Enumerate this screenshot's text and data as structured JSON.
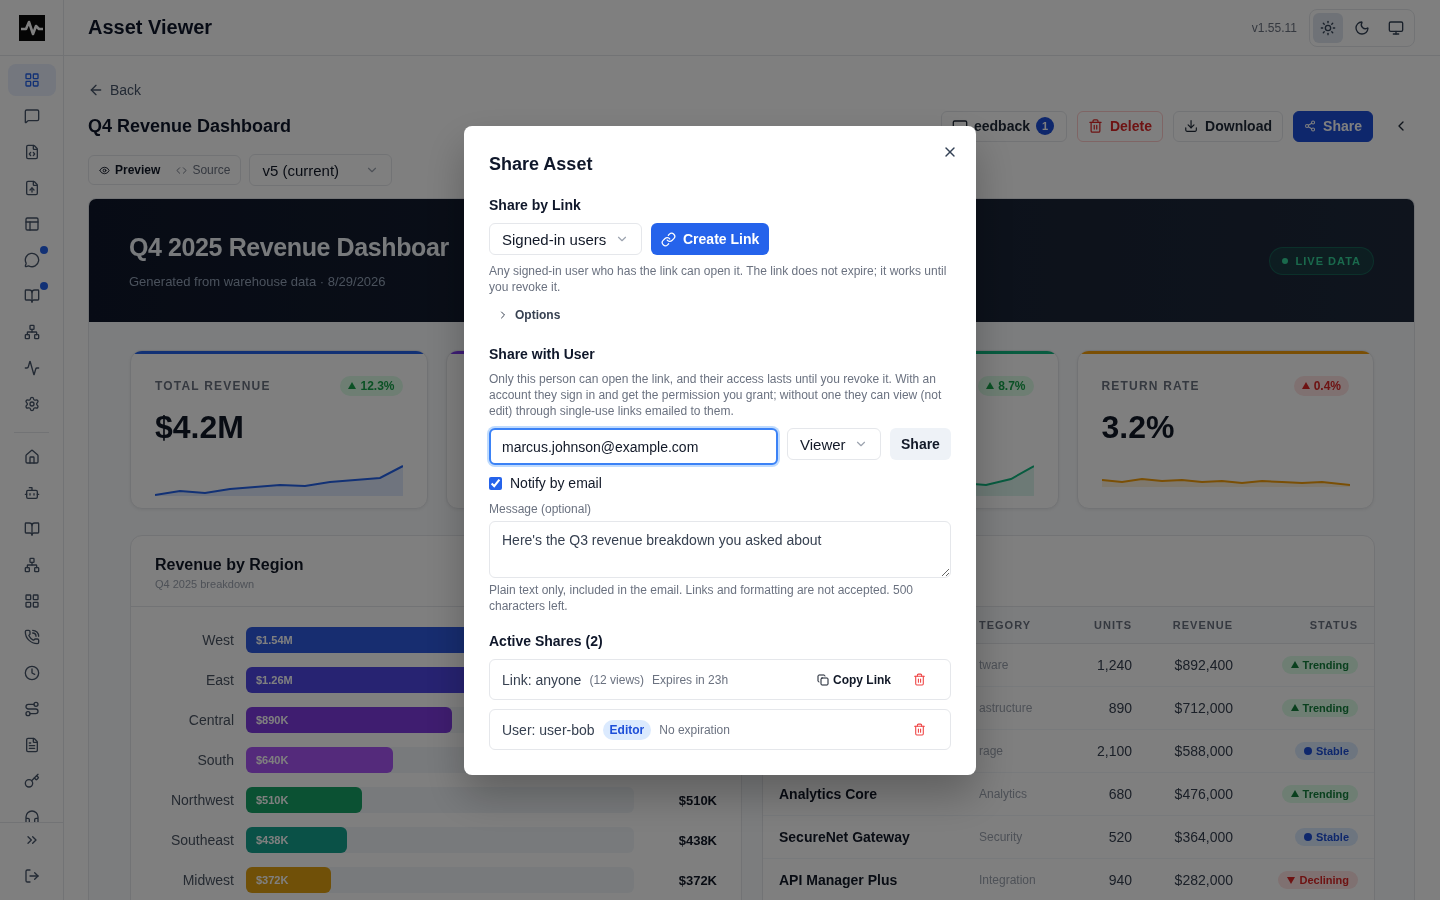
{
  "app": {
    "title": "Asset Viewer",
    "version": "v1.55.11"
  },
  "theme_options": [
    {
      "selected": true
    },
    {
      "selected": false
    },
    {
      "selected": false
    }
  ],
  "nav": {
    "primary": [
      {
        "selected": true,
        "unread": false
      },
      {
        "selected": false,
        "unread": false
      },
      {
        "selected": false,
        "unread": false
      },
      {
        "selected": false,
        "unread": false
      },
      {
        "selected": false,
        "unread": false
      },
      {
        "selected": false,
        "unread": true
      },
      {
        "selected": false,
        "unread": true
      },
      {
        "selected": false,
        "unread": false
      },
      {
        "selected": false,
        "unread": false
      },
      {
        "selected": false,
        "unread": false
      }
    ],
    "secondary": [
      {
        "selected": false
      },
      {
        "selected": false
      },
      {
        "selected": false
      },
      {
        "selected": false
      },
      {
        "selected": false
      },
      {
        "selected": false
      },
      {
        "selected": false
      },
      {
        "selected": false
      },
      {
        "selected": false
      },
      {
        "selected": false
      },
      {
        "selected": false
      }
    ]
  },
  "back": "Back",
  "page_title": "Q4 Revenue Dashboard",
  "actions": [
    {
      "kind": "feedback",
      "label": "eedback",
      "count": "1"
    },
    {
      "kind": "delete",
      "label": "Delete"
    },
    {
      "kind": "download",
      "label": "Download"
    },
    {
      "kind": "share",
      "label": "Share"
    }
  ],
  "view_tabs": [
    {
      "label": "Preview",
      "selected": true
    },
    {
      "label": "Source",
      "selected": false
    }
  ],
  "version_select": {
    "value": "v5 (current)"
  },
  "hero": {
    "title": "Q4 2025 Revenue Dashboar",
    "subtitle": "Generated from warehouse data · 8/29/2026",
    "badge": "LIVE DATA"
  },
  "kpis": [
    {
      "label": "TOTAL REVENUE",
      "value": "$4.2M",
      "delta": "12.3%",
      "negative": false,
      "color": "#123175"
    },
    {
      "color": "#3e1d76"
    },
    {
      "delta": "8.7%",
      "negative": false,
      "color": "#085c40"
    },
    {
      "label": "RETURN RATE",
      "value": "3.2%",
      "delta": "0.4%",
      "negative": true,
      "color": "#7a4f05"
    }
  ],
  "regions": {
    "title": "Revenue by Region",
    "subtitle": "Q4 2025 breakdown",
    "rows": [
      {
        "name": "West",
        "bar_label": "$1.54M",
        "level": 1,
        "color": "#172d70"
      },
      {
        "name": "East",
        "bar_label": "$1.26M",
        "level": 0.82,
        "color": "#272372"
      },
      {
        "name": "Central",
        "bar_label": "$890K",
        "level": 0.53,
        "color": "#3f1d70"
      },
      {
        "name": "South",
        "bar_label": "$640K",
        "level": 0.38,
        "color": "#542a7b"
      },
      {
        "name": "Northwest",
        "bar_label": "$510K",
        "value": "$510K",
        "level": 0.3,
        "color": "#0b5133"
      },
      {
        "name": "Southeast",
        "bar_label": "$438K",
        "value": "$438K",
        "level": 0.26,
        "color": "#0a5147"
      },
      {
        "name": "Midwest",
        "bar_label": "$372K",
        "value": "$372K",
        "level": 0.22,
        "color": "#705008"
      }
    ]
  },
  "products": {
    "columns": [
      "TEGORY",
      "UNITS",
      "REVENUE",
      "STATUS"
    ],
    "rows": [
      {
        "category": "tware",
        "units": "1,240",
        "revenue": "$892,400",
        "status": {
          "kind": "trending",
          "label": "Trending"
        }
      },
      {
        "category": "astructure",
        "units": "890",
        "revenue": "$712,000",
        "status": {
          "kind": "trending",
          "label": "Trending"
        }
      },
      {
        "category": "rage",
        "units": "2,100",
        "revenue": "$588,000",
        "status": {
          "kind": "stable",
          "label": "Stable"
        }
      },
      {
        "name": "Analytics Core",
        "category": "Analytics",
        "units": "680",
        "revenue": "$476,000",
        "status": {
          "kind": "trending",
          "label": "Trending"
        }
      },
      {
        "name": "SecureNet Gateway",
        "category": "Security",
        "units": "520",
        "revenue": "$364,000",
        "status": {
          "kind": "stable",
          "label": "Stable"
        }
      },
      {
        "name": "API Manager Plus",
        "category": "Integration",
        "units": "940",
        "revenue": "$282,000",
        "status": {
          "kind": "declining",
          "label": "Declining"
        }
      }
    ]
  },
  "modal": {
    "title": "Share Asset",
    "link_section": {
      "heading": "Share by Link",
      "audience": "Signed-in users",
      "create_label": "Create Link",
      "help": "Any signed-in user who has the link can open it. The link does not expire; it works until you revoke it.",
      "options": {
        "label": "Options",
        "expanded": false
      }
    },
    "user_section": {
      "heading": "Share with User",
      "help": "Only this person can open the link, and their access lasts until you revoke it. With an account they sign in and get the permission you grant; without one they can view (not edit) through single-use links emailed to them.",
      "email": "marcus.johnson@example.com",
      "role": "Viewer",
      "share_label": "Share",
      "notify": {
        "label": "Notify by email",
        "checked": true
      },
      "message_label": "Message (optional)",
      "message": "Here's the Q3 revenue breakdown you asked about",
      "message_help": "Plain text only, included in the email. Links and formatting are not accepted. 500 characters left."
    },
    "active": {
      "heading": "Active Shares (2)",
      "items": [
        {
          "kind": "link",
          "title": "Link: anyone",
          "views": "(12 views)",
          "expiry": "Expires in 23h",
          "copy_label": "Copy Link"
        },
        {
          "kind": "user",
          "title": "User: user-bob",
          "role": "Editor",
          "expiry": "No expiration"
        }
      ]
    }
  }
}
